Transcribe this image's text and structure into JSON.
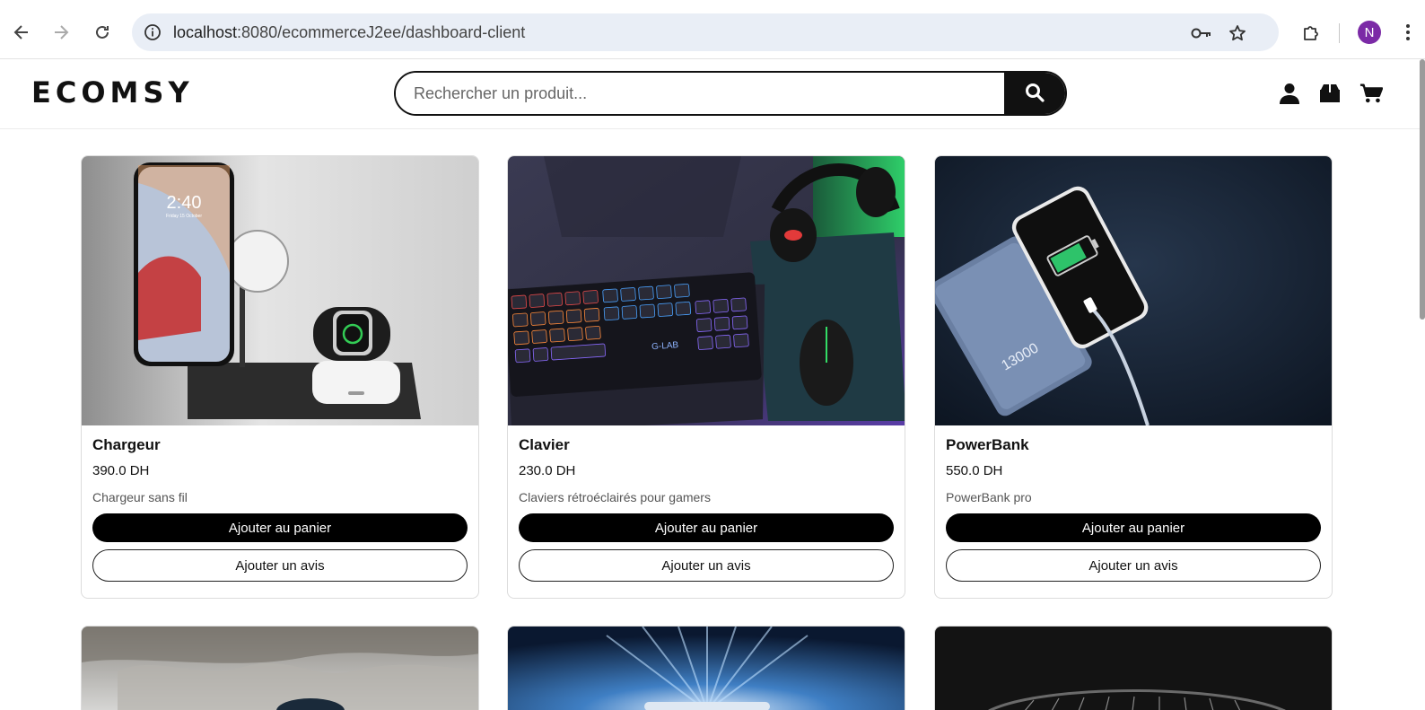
{
  "browser": {
    "url_host": "localhost",
    "url_path": ":8080/ecommerceJ2ee/dashboard-client",
    "profile_initial": "N"
  },
  "site": {
    "logo": "ECOMSY",
    "search_placeholder": "Rechercher un produit..."
  },
  "products": [
    {
      "name": "Chargeur",
      "price": "390.0 DH",
      "description": "Chargeur sans fil",
      "cart_label": "Ajouter au panier",
      "review_label": "Ajouter un avis"
    },
    {
      "name": "Clavier",
      "price": "230.0 DH",
      "description": "Claviers rétroéclairés pour gamers",
      "cart_label": "Ajouter au panier",
      "review_label": "Ajouter un avis"
    },
    {
      "name": "PowerBank",
      "price": "550.0 DH",
      "description": "PowerBank pro",
      "cart_label": "Ajouter au panier",
      "review_label": "Ajouter un avis"
    }
  ],
  "product_images": [
    {
      "text_time": "2:40",
      "text_date": "Friday 15 October"
    },
    {
      "keyboard_brand": "G-LAB"
    },
    {
      "capacity": "13000"
    }
  ],
  "colors": {
    "accent": "#000000",
    "omnibox": "#e9eef6",
    "avatar": "#7b2aa6"
  }
}
